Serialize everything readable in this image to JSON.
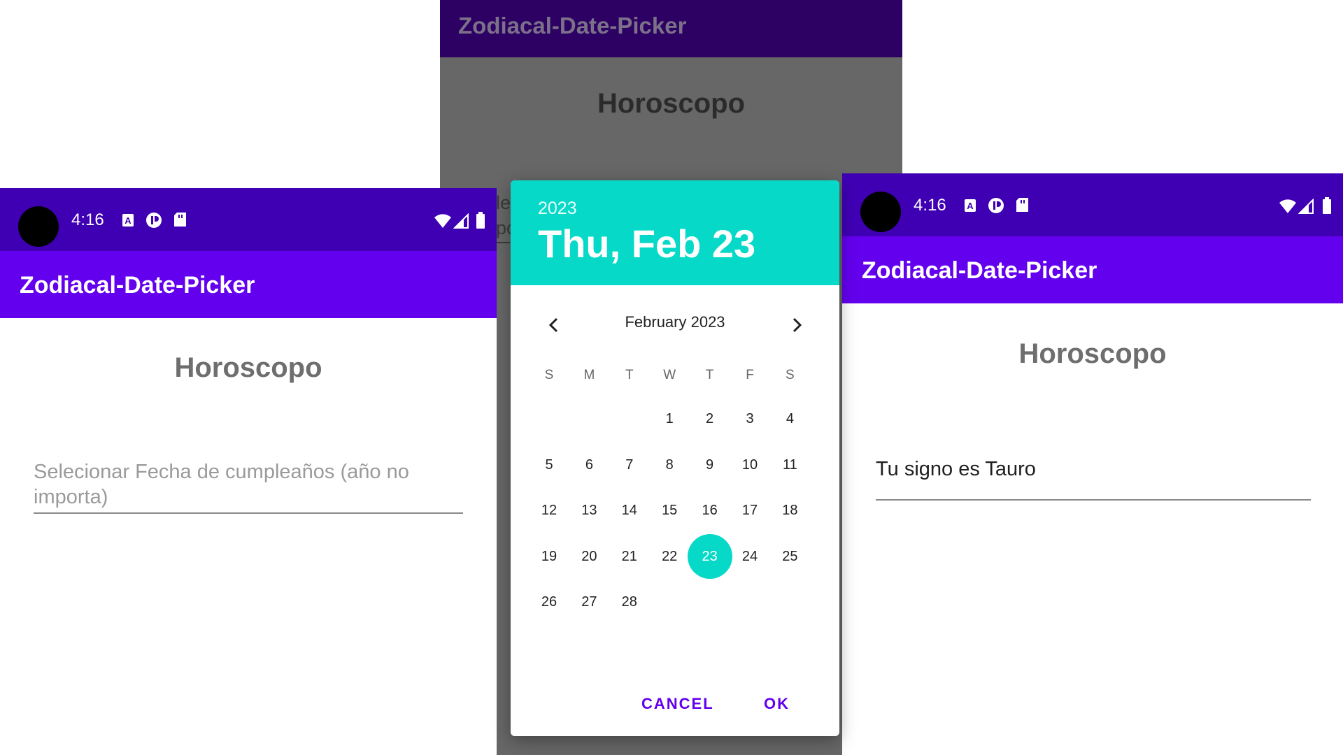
{
  "app_title": "Zodiacal-Date-Picker",
  "screen_heading": "Horoscopo",
  "status_bar": {
    "time": "4:16",
    "left_icons": [
      "text-a-icon",
      "pocket-icon",
      "sd-card-icon"
    ],
    "right_icons": [
      "wifi-icon",
      "signal-icon",
      "battery-icon"
    ]
  },
  "left_screen": {
    "field_placeholder": "Selecionar Fecha de cumpleaños (año no importa)"
  },
  "middle_screen": {
    "field_fragment_line1": "le",
    "field_fragment_line2": "pc"
  },
  "date_picker": {
    "header_year": "2023",
    "header_date": "Thu, Feb 23",
    "month_label": "February 2023",
    "weekdays": [
      "S",
      "M",
      "T",
      "W",
      "T",
      "F",
      "S"
    ],
    "first_weekday_index": 3,
    "days_in_month": 28,
    "selected_day": 23,
    "cancel_label": "CANCEL",
    "ok_label": "OK"
  },
  "right_screen": {
    "field_value": "Tu signo es Tauro"
  },
  "colors": {
    "status_bar": "#3f00b4",
    "app_bar": "#6300ed",
    "accent_teal": "#06d9c7",
    "button_purple": "#6200ee",
    "scrim": "#676767"
  }
}
